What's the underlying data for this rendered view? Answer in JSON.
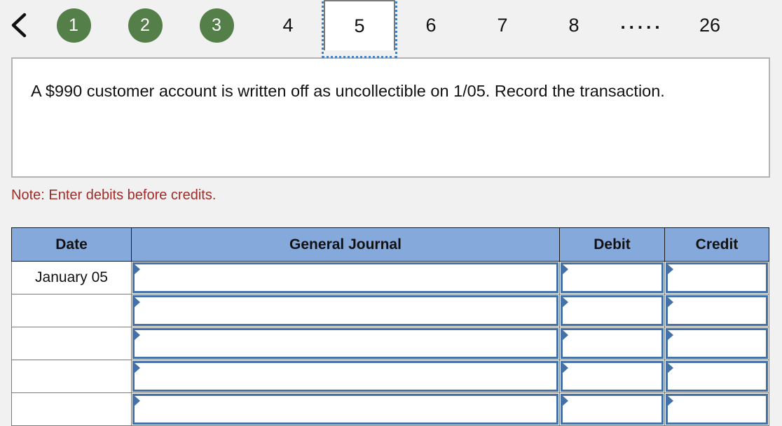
{
  "pagination": {
    "back_icon": "chevron-left-icon",
    "items": [
      {
        "label": "1",
        "state": "done"
      },
      {
        "label": "2",
        "state": "done"
      },
      {
        "label": "3",
        "state": "done"
      },
      {
        "label": "4",
        "state": "normal"
      },
      {
        "label": "5",
        "state": "current"
      },
      {
        "label": "6",
        "state": "normal"
      },
      {
        "label": "7",
        "state": "normal"
      },
      {
        "label": "8",
        "state": "normal"
      },
      {
        "label": ".....",
        "state": "ellipsis"
      },
      {
        "label": "26",
        "state": "normal"
      }
    ]
  },
  "question": {
    "text": "A $990 customer account is written off as uncollectible on 1/05. Record the transaction."
  },
  "note": {
    "text": "Note: Enter debits before credits."
  },
  "journal": {
    "columns": [
      "Date",
      "General Journal",
      "Debit",
      "Credit"
    ],
    "rows": [
      {
        "date": "January 05",
        "general_journal": "",
        "debit": "",
        "credit": ""
      },
      {
        "date": "",
        "general_journal": "",
        "debit": "",
        "credit": ""
      },
      {
        "date": "",
        "general_journal": "",
        "debit": "",
        "credit": ""
      },
      {
        "date": "",
        "general_journal": "",
        "debit": "",
        "credit": ""
      },
      {
        "date": "",
        "general_journal": "",
        "debit": "",
        "credit": ""
      }
    ]
  },
  "colors": {
    "page_background": "#f1f1f1",
    "tab_done_green": "#547f49",
    "table_header_blue": "#86a9db",
    "input_border_blue": "#4472a8",
    "note_red": "#a02c27",
    "panel_border_gray": "#b3b3b3"
  }
}
